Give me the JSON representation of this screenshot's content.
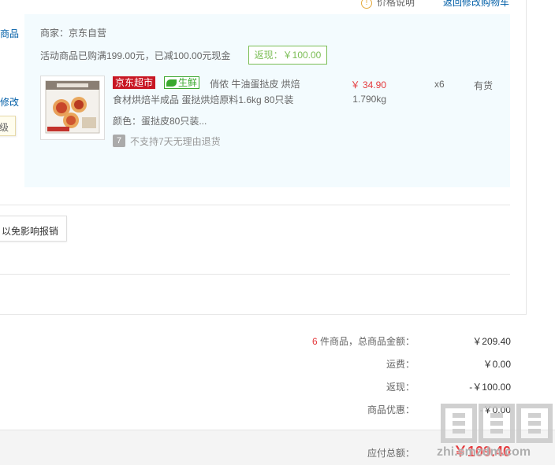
{
  "top": {
    "tip_text": "价格说明",
    "link_text": "返回修改购物车"
  },
  "left": {
    "text1": "商品",
    "text2": "修改",
    "tip": "级"
  },
  "shop": {
    "seller": "商家：京东自营",
    "promo": "活动商品已购满199.00元，已减100.00元现金",
    "rebate": "返现：￥100.00"
  },
  "item": {
    "tag_jd": "京东超市",
    "tag_fresh": "生鲜",
    "title_line1": "俏侬 牛油蛋挞皮 烘焙",
    "title_line2": "食材烘焙半成品 蛋挞烘焙原料1.6kg 80只装",
    "color": "颜色：蛋挞皮80只装...",
    "no_return_icon": "7",
    "no_return": "不支持7天无理由退货",
    "price": "￥ 34.90",
    "weight": "1.790kg",
    "qty": "x6",
    "stock": "有货",
    "thumb_icon": "egg-tart-box-image"
  },
  "invoice": {
    "tip": "以免影响报销"
  },
  "summary": {
    "count": "6",
    "count_suffix": " 件商品，总商品金额：",
    "goods_total": "￥209.40",
    "shipping_label": "运费：",
    "shipping": "￥0.00",
    "rebate_label": "返现：",
    "rebate": "-￥100.00",
    "discount_label": "商品优惠：",
    "discount": "-￥0.00",
    "payable_label": "应付总额：",
    "payable": "￥109.40"
  },
  "watermark": {
    "site": "zhi.smzdm.com",
    "glyphs": "值值值"
  },
  "colors": {
    "accent_red": "#e4393c",
    "link_blue": "#005ea7",
    "green": "#7abd54",
    "panel_bg": "#f3fbfe"
  }
}
